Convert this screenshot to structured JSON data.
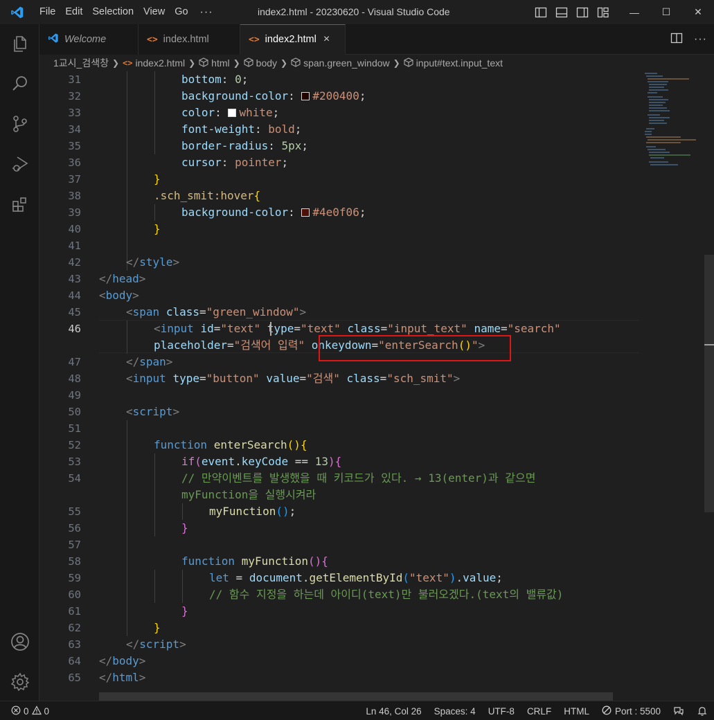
{
  "titlebar": {
    "menu": [
      "File",
      "Edit",
      "Selection",
      "View",
      "Go"
    ],
    "more": "···",
    "title": "index2.html - 20230620 - Visual Studio Code",
    "minimize": "—",
    "maximize": "☐",
    "close": "✕"
  },
  "tabs": {
    "welcome": "Welcome",
    "index": "index.html",
    "index2": "index2.html",
    "close": "×",
    "split": "◫",
    "more": "···"
  },
  "breadcrumb": {
    "folder": "1교시_검색창",
    "file": "index2.html",
    "c1": "html",
    "c2": "body",
    "c3": "span.green_window",
    "c4": "input#text.input_text"
  },
  "editor": {
    "colors": {
      "c200400": "#200400",
      "white": "#ffffff",
      "c4e0f06": "#4e0f06"
    },
    "line_numbers": [
      "31",
      "32",
      "33",
      "34",
      "35",
      "36",
      "37",
      "38",
      "39",
      "40",
      "41",
      "42",
      "43",
      "44",
      "45",
      "46",
      "47",
      "48",
      "49",
      "50",
      "51",
      "52",
      "53",
      "54",
      "55",
      "56",
      "57",
      "58",
      "59",
      "60",
      "61",
      "62",
      "63",
      "64",
      "65"
    ],
    "l31": {
      "p": "bottom",
      "v": "0"
    },
    "l32": {
      "p": "background-color",
      "v": "#200400"
    },
    "l33": {
      "p": "color",
      "v": "white"
    },
    "l34": {
      "p": "font-weight",
      "v": "bold"
    },
    "l35": {
      "p": "border-radius",
      "v": "5",
      "u": "px"
    },
    "l36": {
      "p": "cursor",
      "v": "pointer"
    },
    "l38": {
      "sel": ".sch_smit:hover"
    },
    "l39": {
      "p": "background-color",
      "v": "#4e0f06"
    },
    "l42": {
      "tag": "style"
    },
    "l43": {
      "tag": "head"
    },
    "l44": {
      "tag": "body"
    },
    "l45": {
      "tag": "span",
      "a1": "class",
      "v1": "\"green_window\""
    },
    "l46": {
      "tag": "input",
      "a1": "id",
      "v1": "\"text\"",
      "a2": "type",
      "v2": "\"text\"",
      "a3": "class",
      "v3": "\"input_text\"",
      "a4": "name",
      "v4": "\"search\"",
      "a5": "placeholder",
      "v5": "\"검색어 입력\"",
      "a6": "onkeydown",
      "v6a": "\"enterSearch",
      "v6b": "()",
      "v6c": "\""
    },
    "l47": {
      "tag": "span"
    },
    "l48": {
      "tag": "input",
      "a1": "type",
      "v1": "\"button\"",
      "a2": "value",
      "v2": "\"검색\"",
      "a3": "class",
      "v3": "\"sch_smit\""
    },
    "l50": {
      "tag": "script"
    },
    "l52": {
      "kw": "function",
      "fn": "enterSearch"
    },
    "l53": {
      "kw": "if",
      "obj": "event",
      "prop": "keyCode",
      "op": "==",
      "num": "13"
    },
    "l54": {
      "c1": "// 만약이벤트를 발생했을 때 키코드가 있다. → 13(enter)과 같으면",
      "c2": "myFunction을 실행시켜라"
    },
    "l55": {
      "fn": "myFunction"
    },
    "l58": {
      "kw": "function",
      "fn": "myFunction"
    },
    "l59": {
      "kw": "let",
      "op": "=",
      "obj": "document",
      "fn": "getElementById",
      "str": "\"text\"",
      "prop": "value"
    },
    "l60": {
      "c": "// 함수 지정을 하는데 아이디(text)만 불러오겠다.(text의 밸류값)"
    },
    "l63": {
      "tag": "script"
    },
    "l64": {
      "tag": "body"
    },
    "l65": {
      "tag": "html"
    }
  },
  "statusbar": {
    "errors": "0",
    "warnings": "0",
    "position": "Ln 46, Col 26",
    "spaces": "Spaces: 4",
    "encoding": "UTF-8",
    "eol": "CRLF",
    "language": "HTML",
    "port": "Port : 5500"
  }
}
